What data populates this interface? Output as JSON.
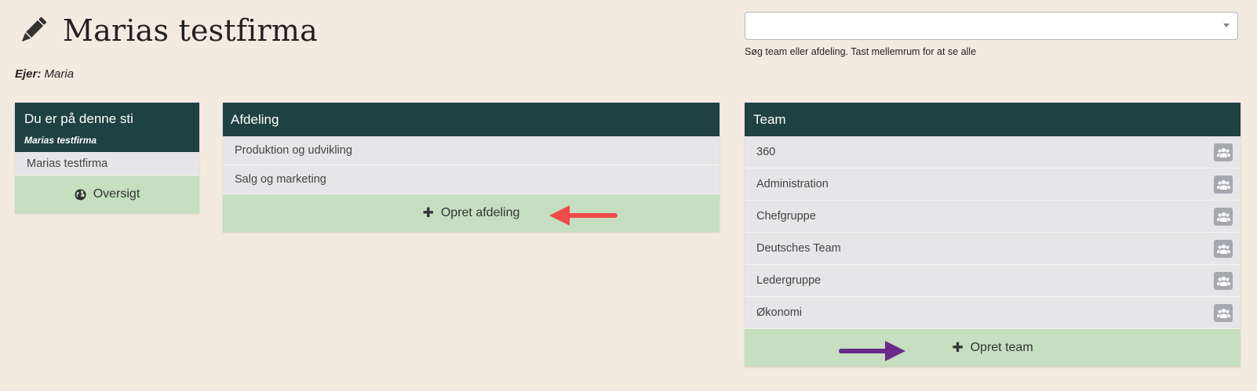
{
  "header": {
    "title": "Marias testfirma"
  },
  "owner": {
    "label": "Ejer:",
    "name": "Maria"
  },
  "search": {
    "value": "",
    "hint": "Søg team eller afdeling. Tast mellemrum for at se alle"
  },
  "path_panel": {
    "title": "Du er på denne sti",
    "subtitle": "Marias testfirma",
    "items": [
      {
        "label": "Marias testfirma"
      }
    ],
    "action_label": "Oversigt",
    "action_icon": "globe-icon"
  },
  "dept_panel": {
    "title": "Afdeling",
    "items": [
      {
        "label": "Produktion og udvikling"
      },
      {
        "label": "Salg og marketing"
      }
    ],
    "action_label": "Opret afdeling",
    "action_icon": "plus-icon"
  },
  "team_panel": {
    "title": "Team",
    "items": [
      {
        "label": "360"
      },
      {
        "label": "Administration"
      },
      {
        "label": "Chefgruppe"
      },
      {
        "label": "Deutsches Team"
      },
      {
        "label": "Ledergruppe"
      },
      {
        "label": "Økonomi"
      }
    ],
    "item_icon": "users-icon",
    "action_label": "Opret team",
    "action_icon": "plus-icon"
  },
  "colors": {
    "background": "#f4ebe0",
    "panel_header": "#1e4143",
    "row": "#e6e6e9",
    "action": "#c5dfc0",
    "annotation_red": "#f04a4a",
    "annotation_purple": "#6b2a8c"
  }
}
